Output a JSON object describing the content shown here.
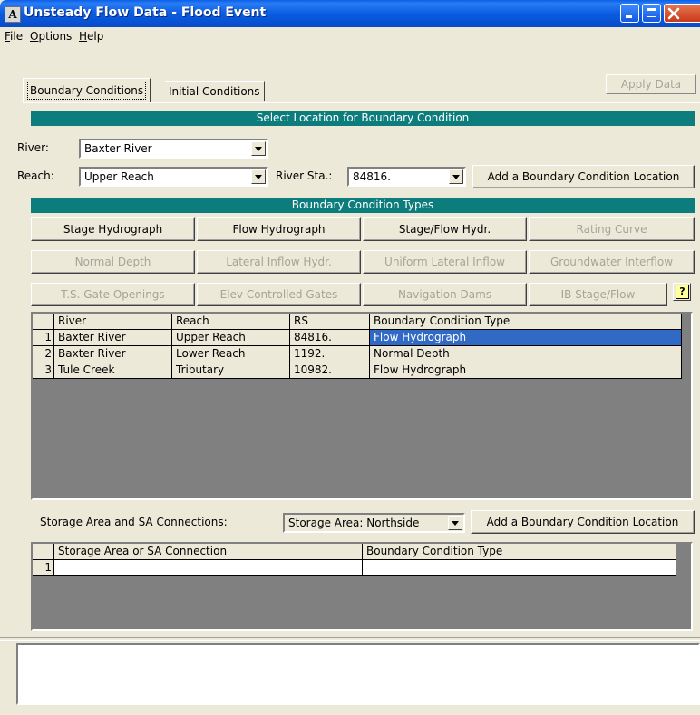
{
  "window": {
    "title": "Unsteady Flow Data - Flood Event",
    "app_icon_glyph": "A"
  },
  "menu": {
    "file": "File",
    "options": "Options",
    "help": "Help"
  },
  "tabs": {
    "boundary": "Boundary Conditions",
    "initial": "Initial Conditions"
  },
  "apply_button": "Apply Data",
  "location_section": {
    "header": "Select Location for Boundary Condition",
    "river_label": "River:",
    "river_value": "Baxter River",
    "reach_label": "Reach:",
    "reach_value": "Upper Reach",
    "river_sta_label": "River Sta.:",
    "river_sta_value": "84816.",
    "add_location_button": "Add a Boundary Condition Location"
  },
  "types_section": {
    "header": "Boundary Condition Types",
    "buttons": [
      {
        "label": "Stage Hydrograph",
        "enabled": true
      },
      {
        "label": "Flow Hydrograph",
        "enabled": true
      },
      {
        "label": "Stage/Flow Hydr.",
        "enabled": true
      },
      {
        "label": "Rating Curve",
        "enabled": false
      },
      {
        "label": "Normal Depth",
        "enabled": false
      },
      {
        "label": "Lateral Inflow Hydr.",
        "enabled": false
      },
      {
        "label": "Uniform Lateral Inflow",
        "enabled": false
      },
      {
        "label": "Groundwater Interflow",
        "enabled": false
      },
      {
        "label": "T.S. Gate Openings",
        "enabled": false
      },
      {
        "label": "Elev Controlled Gates",
        "enabled": false
      },
      {
        "label": "Navigation Dams",
        "enabled": false
      },
      {
        "label": "IB Stage/Flow",
        "enabled": false
      }
    ],
    "help_glyph": "?"
  },
  "bc_table": {
    "headers": [
      "River",
      "Reach",
      "RS",
      "Boundary Condition Type"
    ],
    "rows": [
      {
        "num": "1",
        "river": "Baxter River",
        "reach": "Upper Reach",
        "rs": "84816.",
        "type": "Flow Hydrograph",
        "selected": true
      },
      {
        "num": "2",
        "river": "Baxter River",
        "reach": "Lower Reach",
        "rs": "1192.",
        "type": "Normal Depth",
        "selected": false
      },
      {
        "num": "3",
        "river": "Tule Creek",
        "reach": "Tributary",
        "rs": "10982.",
        "type": "Flow Hydrograph",
        "selected": false
      }
    ]
  },
  "storage_section": {
    "label": "Storage Area and SA Connections:",
    "combo_value": "Storage Area: Northside",
    "add_location_button": "Add a Boundary Condition Location"
  },
  "sa_table": {
    "headers": [
      "Storage Area or SA Connection",
      "Boundary Condition Type"
    ],
    "rows": [
      {
        "num": "1",
        "area": "",
        "type": ""
      }
    ]
  }
}
